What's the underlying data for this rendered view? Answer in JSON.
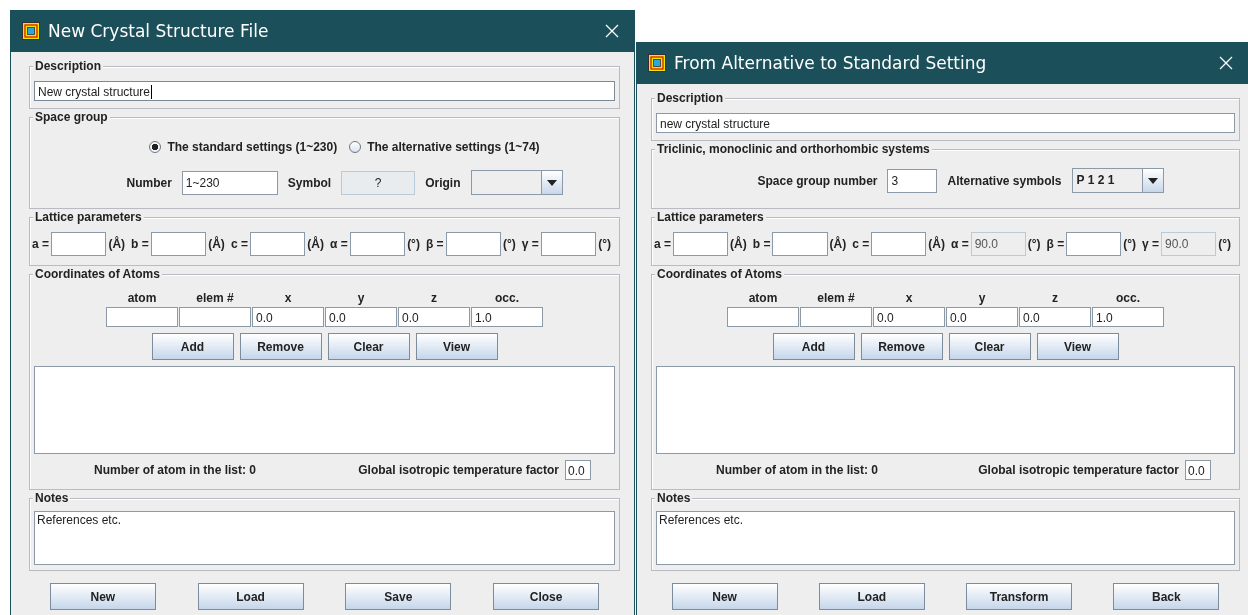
{
  "windows": [
    {
      "title": "New Crystal Structure File",
      "sections": [
        {
          "kind": "text",
          "label": "Description",
          "value": "New crystal structure",
          "focused": true
        },
        {
          "kind": "form",
          "label": "Space group",
          "radios": [
            {
              "label": "The standard settings (1~230)",
              "selected": true
            },
            {
              "label": "The alternative settings (1~74)",
              "selected": false
            }
          ],
          "items": [
            {
              "kind": "label",
              "text": "Number"
            },
            {
              "kind": "field",
              "value": "1~230"
            },
            {
              "kind": "label",
              "text": "Symbol"
            },
            {
              "kind": "readonly",
              "value": "?"
            },
            {
              "kind": "label",
              "text": "Origin"
            },
            {
              "kind": "combo"
            }
          ]
        },
        {
          "kind": "lattice",
          "label": "Lattice parameters",
          "params": [
            {
              "name": "a =",
              "unit": "(Å)",
              "disabled": false
            },
            {
              "name": "b =",
              "unit": "(Å)",
              "disabled": false
            },
            {
              "name": "c =",
              "unit": "(Å)",
              "disabled": false
            },
            {
              "name": "α =",
              "unit": "(°)",
              "disabled": false
            },
            {
              "name": "β =",
              "unit": "(°)",
              "disabled": false
            },
            {
              "name": "γ =",
              "unit": "(°)",
              "disabled": false
            }
          ]
        },
        {
          "kind": "atoms",
          "label": "Coordinates of Atoms",
          "columns": [
            {
              "label": "atom"
            },
            {
              "label": "elem #"
            },
            {
              "label": "x",
              "value": "0.0"
            },
            {
              "label": "y",
              "value": "0.0"
            },
            {
              "label": "z",
              "value": "0.0"
            },
            {
              "label": "occ.",
              "value": "1.0"
            }
          ],
          "buttons": [
            "Add",
            "Remove",
            "Clear",
            "View"
          ],
          "count": "Number of atom in the list: 0",
          "factor_label": "Global isotropic temperature factor",
          "factor_value": "0.0"
        },
        {
          "kind": "notes",
          "label": "Notes",
          "value": "References etc."
        }
      ],
      "buttons": [
        "New",
        "Load",
        "Save",
        "Close"
      ]
    },
    {
      "title": "From Alternative to Standard Setting",
      "sections": [
        {
          "kind": "text",
          "label": "Description",
          "value": "new crystal structure",
          "focused": false
        },
        {
          "kind": "form",
          "label": "Triclinic, monoclinic and orthorhombic systems",
          "items": [
            {
              "kind": "label",
              "text": "Space group number"
            },
            {
              "kind": "field",
              "value": "3"
            },
            {
              "kind": "label",
              "text": "Alternative symbols"
            },
            {
              "kind": "combo",
              "value": "P 1 2 1"
            }
          ]
        },
        {
          "kind": "lattice",
          "label": "Lattice parameters",
          "params": [
            {
              "name": "a =",
              "unit": "(Å)",
              "disabled": false
            },
            {
              "name": "b =",
              "unit": "(Å)",
              "disabled": false
            },
            {
              "name": "c =",
              "unit": "(Å)",
              "disabled": false
            },
            {
              "name": "α =",
              "unit": "(°)",
              "value": "90.0",
              "disabled": true
            },
            {
              "name": "β =",
              "unit": "(°)",
              "disabled": false
            },
            {
              "name": "γ =",
              "unit": "(°)",
              "value": "90.0",
              "disabled": true
            }
          ]
        },
        {
          "kind": "atoms",
          "label": "Coordinates of Atoms",
          "columns": [
            {
              "label": "atom"
            },
            {
              "label": "elem #"
            },
            {
              "label": "x",
              "value": "0.0"
            },
            {
              "label": "y",
              "value": "0.0"
            },
            {
              "label": "z",
              "value": "0.0"
            },
            {
              "label": "occ.",
              "value": "1.0"
            }
          ],
          "buttons": [
            "Add",
            "Remove",
            "Clear",
            "View"
          ],
          "count": "Number of atom in the list: 0",
          "factor_label": "Global isotropic temperature factor",
          "factor_value": "0.0"
        },
        {
          "kind": "notes",
          "label": "Notes",
          "value": "References etc."
        }
      ],
      "buttons": [
        "New",
        "Load",
        "Transform",
        "Back"
      ]
    }
  ]
}
